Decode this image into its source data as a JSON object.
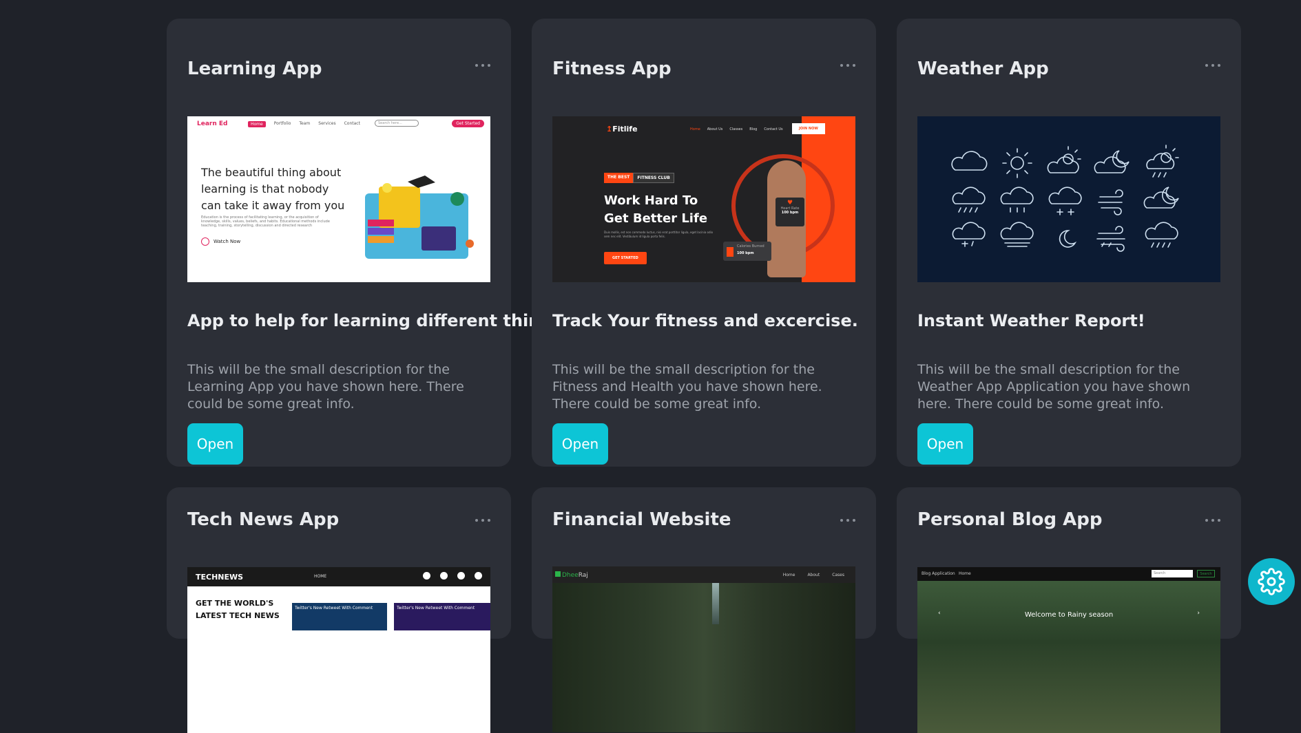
{
  "cards": [
    {
      "title": "Learning App",
      "subtitle": "App to help for learning different things.",
      "description": "This will be the small description for the Learning App you have shown here. There could be some great info.",
      "button_label": "Open",
      "thumb": {
        "logo": "Learn Ed",
        "nav": [
          "Home",
          "Portfolio",
          "Team",
          "Services",
          "Contact"
        ],
        "search_placeholder": "Search here...",
        "cta": "Get Started",
        "headline": "The beautiful thing about learning is that nobody can take it away from you",
        "blurb": "Education is the process of facilitating learning, or the acquisition of knowledge, skills, values, beliefs, and habits. Educational methods include teaching, training, storytelling, discussion and directed research",
        "watch": "Watch Now"
      }
    },
    {
      "title": "Fitness App",
      "subtitle": "Track Your fitness and excercise.",
      "description": "This will be the small description for the Fitness and Health you have shown here. There could be some great info.",
      "button_label": "Open",
      "thumb": {
        "logo": "Fitlife",
        "nav": [
          "Home",
          "About Us",
          "Classes",
          "Blog",
          "Contact Us"
        ],
        "join": "JOIN NOW",
        "tag_a": "THE BEST",
        "tag_b": "FITNESS CLUB",
        "headline_1": "Work Hard To",
        "headline_2": "Get Better Life",
        "blurb": "Duis mollis, est non commodo luctus, nisi erat porttitor ligula, eget lacinia odio sem nec elit. Vestibulum id ligula porta felis.",
        "button": "GET STARTED",
        "heart_label": "Heart Rate",
        "bpm_1": "100 bpm",
        "calories_label": "Calories Burned",
        "bpm_2": "100 bpm"
      }
    },
    {
      "title": "Weather App",
      "subtitle": "Instant Weather Report!",
      "description": "This will be the small description for the Weather App Application you have shown here. There could be some great info.",
      "button_label": "Open"
    },
    {
      "title": "Tech News App",
      "thumb": {
        "logo": "TECHNEWS",
        "home": "HOME",
        "headline_1": "GET THE WORLD'S",
        "headline_2": "LATEST TECH NEWS",
        "tile_1": "Twitter's New Retweet With Comment",
        "tile_2": "Twitter's New Retweet With Comment"
      }
    },
    {
      "title": "Financial Website",
      "thumb": {
        "logo_green": "Dhee",
        "logo_rest": "Raj",
        "nav": [
          "Home",
          "About",
          "Cases"
        ]
      }
    },
    {
      "title": "Personal Blog App",
      "thumb": {
        "brand": "Blog Application",
        "home": "Home",
        "search_placeholder": "Search",
        "search_button": "Search",
        "caption": "Welcome to Rainy season"
      }
    }
  ],
  "colors": {
    "page_bg": "#1f2229",
    "card_bg": "#2c2f37",
    "accent": "#0dc5d6"
  },
  "icons": {
    "card_menu": "more-horizontal-icon",
    "fab": "gear-icon"
  }
}
